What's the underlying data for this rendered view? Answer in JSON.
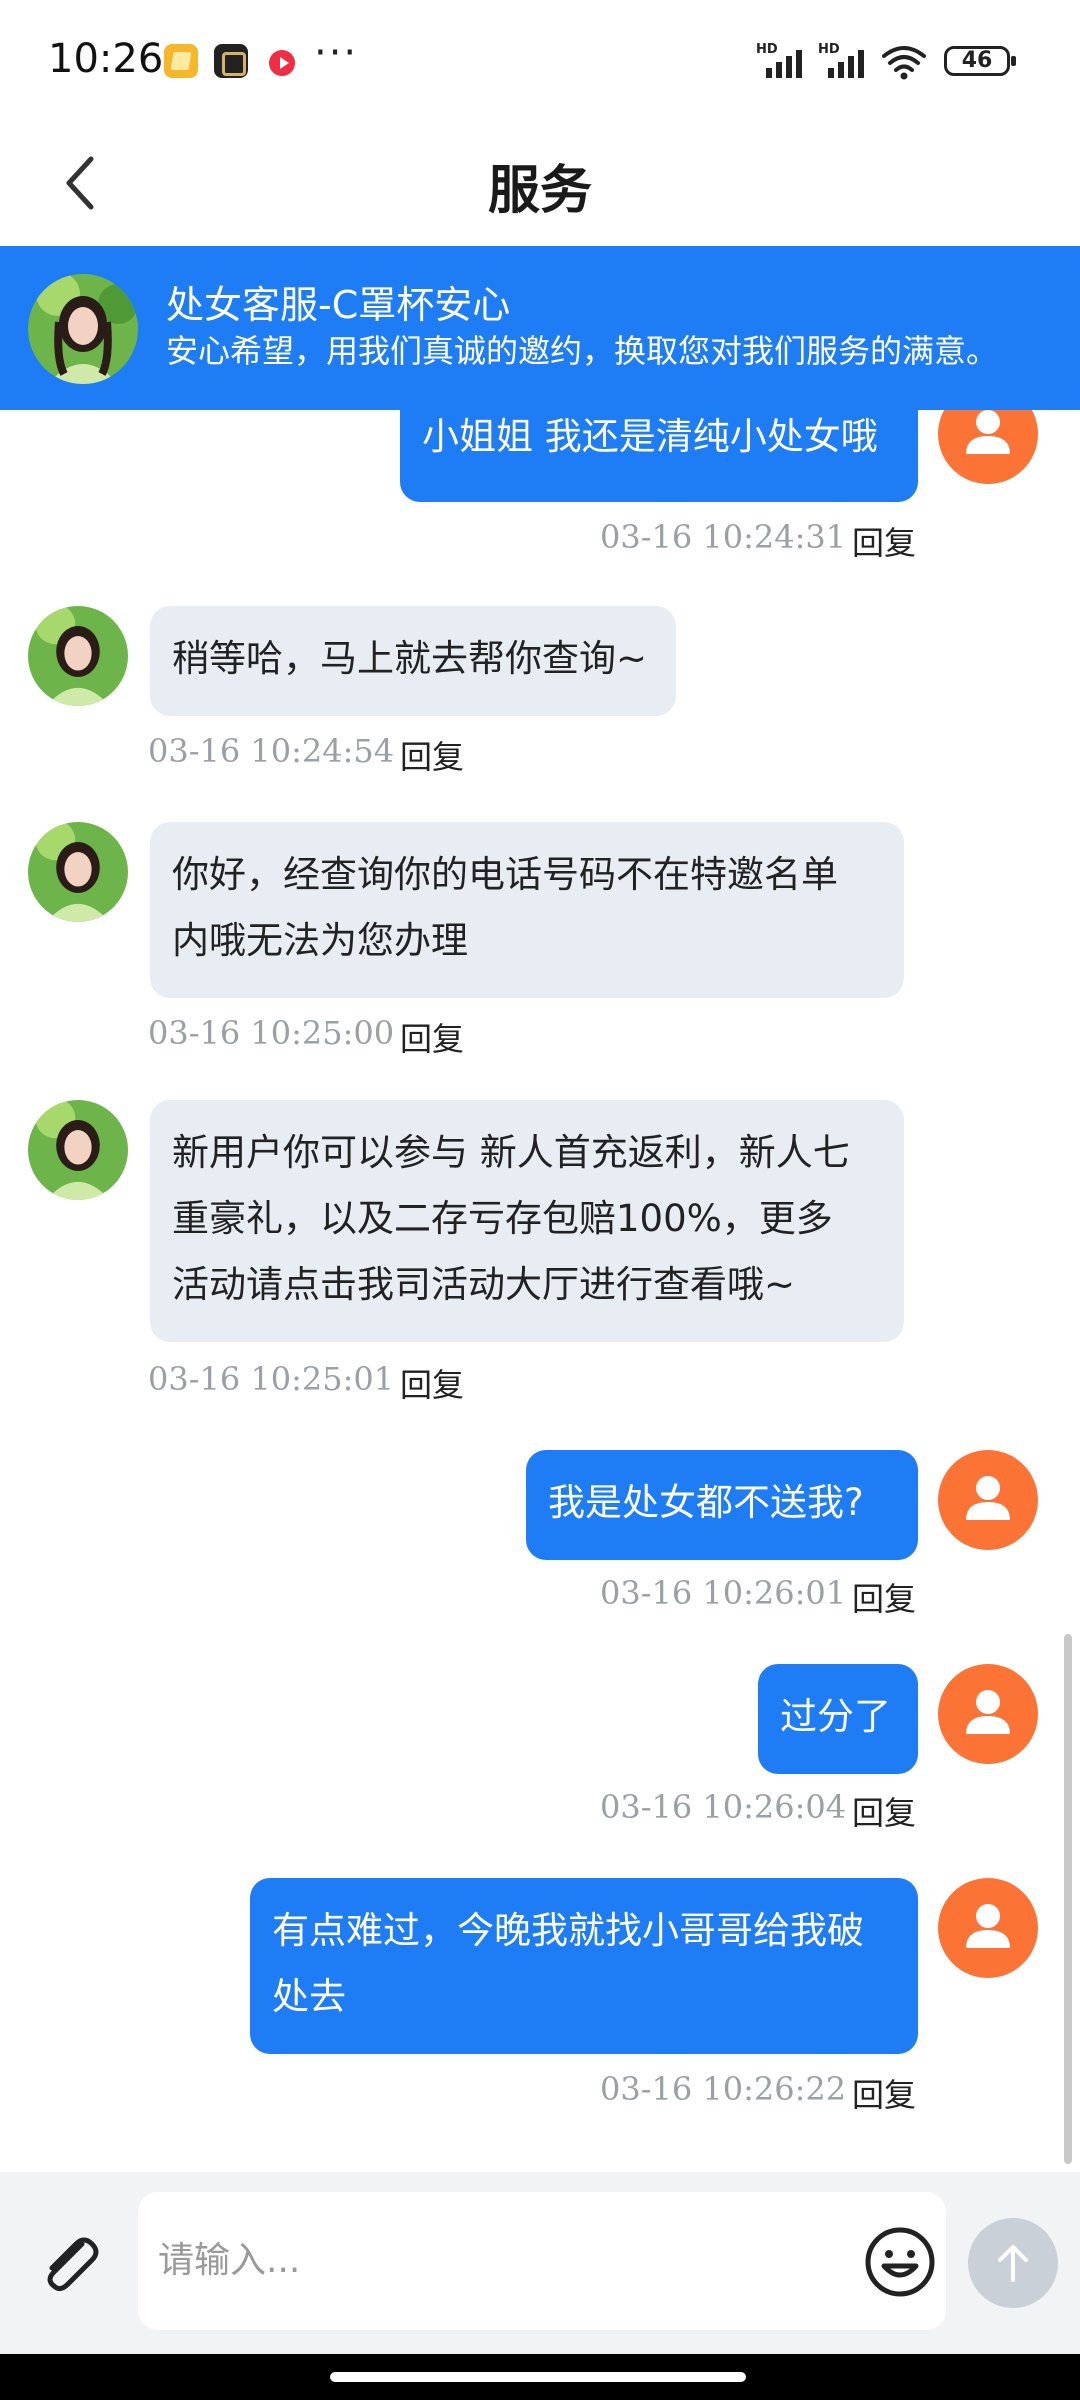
{
  "status_bar": {
    "time": "10:26",
    "more": "···",
    "signal_label": "HD",
    "battery": "46",
    "app_icons": [
      "notes-app-icon",
      "game-app-icon",
      "video-app-icon"
    ]
  },
  "nav": {
    "title": "服务"
  },
  "agent": {
    "name": "处女客服-C罩杯安心",
    "slogan": "安心希望，用我们真诚的邀约，换取您对我们服务的满意。"
  },
  "messages": [
    {
      "sender": "user",
      "lines": [
        "小姐姐 我还是清纯小处女哦"
      ],
      "time": "03-16 10:24:31",
      "reply": "回复"
    },
    {
      "sender": "agent",
      "lines": [
        "稍等哈，马上就去帮你查询~"
      ],
      "time": "03-16 10:24:54",
      "reply": "回复"
    },
    {
      "sender": "agent",
      "lines": [
        "你好，经查询你的电话号码不在特邀名单",
        "内哦无法为您办理"
      ],
      "time": "03-16 10:25:00",
      "reply": "回复"
    },
    {
      "sender": "agent",
      "lines": [
        "新用户你可以参与 新人首充返利，新人七",
        "重豪礼，以及二存亏存包赔100%，更多",
        "活动请点击我司活动大厅进行查看哦~"
      ],
      "time": "03-16 10:25:01",
      "reply": "回复"
    },
    {
      "sender": "user",
      "lines": [
        "我是处女都不送我?"
      ],
      "time": "03-16 10:26:01",
      "reply": "回复"
    },
    {
      "sender": "user",
      "lines": [
        "过分了"
      ],
      "time": "03-16 10:26:04",
      "reply": "回复"
    },
    {
      "sender": "user",
      "lines": [
        "有点难过，今晚我就找小哥哥给我破",
        "处去"
      ],
      "time": "03-16 10:26:22",
      "reply": "回复"
    }
  ],
  "input": {
    "placeholder": "请输入...",
    "value": ""
  },
  "colors": {
    "brand_blue": "#1e7cf5",
    "user_avatar": "#fb7436",
    "agent_bubble": "#e8edf4",
    "input_bar_bg": "#f2f3f5",
    "send_disabled": "#c9d0d8"
  }
}
